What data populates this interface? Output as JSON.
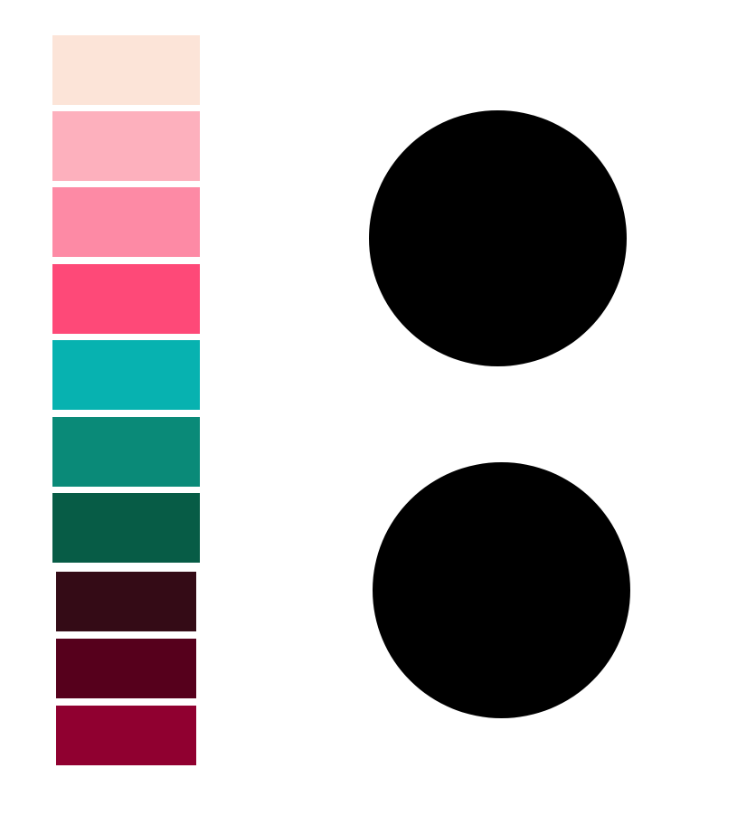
{
  "palette": {
    "swatches": [
      {
        "color": "#fce4d8"
      },
      {
        "color": "#fdb0bd"
      },
      {
        "color": "#fd8aa5"
      },
      {
        "color": "#fe4978"
      },
      {
        "color": "#07b2b0"
      },
      {
        "color": "#0a8a78"
      },
      {
        "color": "#075c46"
      },
      {
        "color": "#340b16"
      },
      {
        "color": "#56001c"
      },
      {
        "color": "#900030"
      }
    ]
  },
  "dots": {
    "top": {
      "color": "#000000"
    },
    "bottom": {
      "color": "#000000"
    }
  }
}
